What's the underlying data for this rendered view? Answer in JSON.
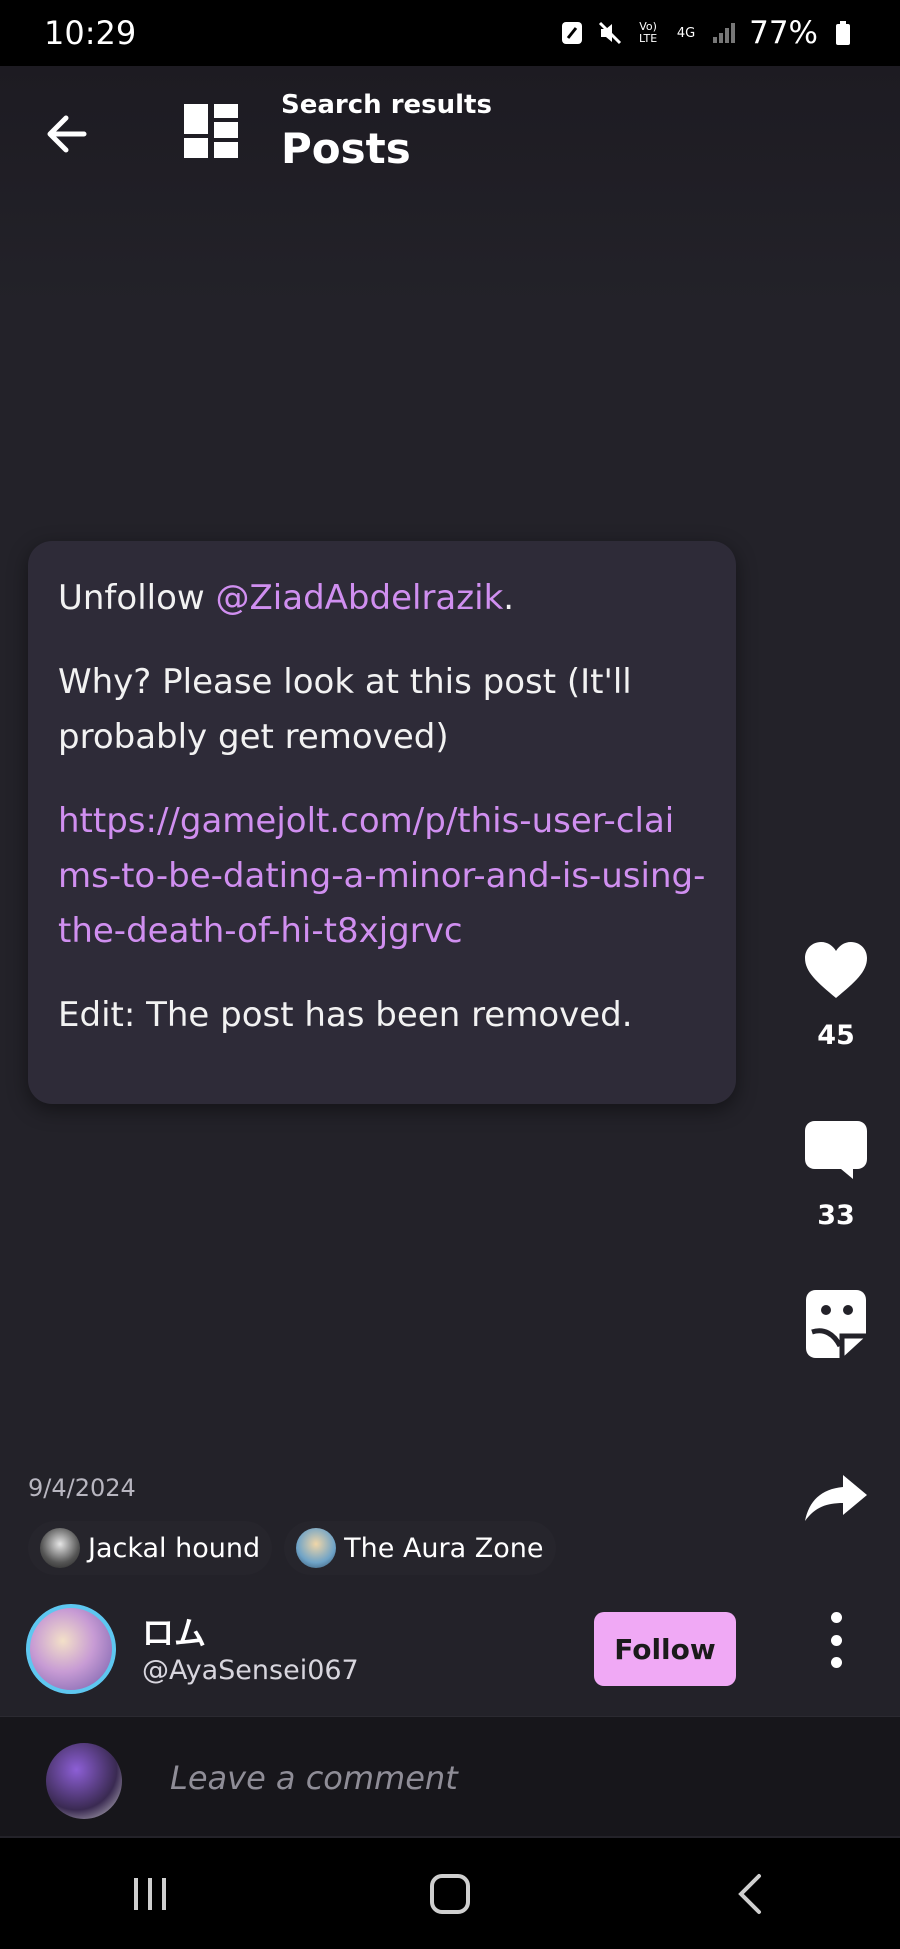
{
  "status_bar": {
    "time": "10:29",
    "battery": "77%",
    "icons": [
      "nfc-icon",
      "mute-icon",
      "volte-icon",
      "4g-icon",
      "signal-icon",
      "battery-icon"
    ],
    "volte_label_1": "Vo)",
    "volte_label_2": "LTE",
    "network_label": "4G"
  },
  "header": {
    "subtitle": "Search results",
    "title": "Posts",
    "back_icon": "arrow-left-icon",
    "grid_icon": "grid-layout-icon"
  },
  "post": {
    "line1_prefix": "Unfollow ",
    "mention": "@ZiadAbdelrazik",
    "line1_suffix": ".",
    "paragraph2": "Why? Please look at this post (It'll probably get removed)",
    "link": "https://gamejolt.com/p/this-user-claims-to-be-dating-a-minor-and-is-using-the-death-of-hi-t8xjgrvc",
    "paragraph4": "Edit: The post has been removed.",
    "date": "9/4/2024",
    "tags": [
      {
        "label": "Jackal hound"
      },
      {
        "label": "The Aura Zone"
      }
    ]
  },
  "actions": {
    "like_count": "45",
    "comment_count": "33",
    "like_icon": "heart-icon",
    "comment_icon": "comment-bubble-icon",
    "sticker_icon": "sticker-icon",
    "share_icon": "share-arrow-icon"
  },
  "author": {
    "name": "ロム",
    "handle": "@AyaSensei067",
    "follow_label": "Follow"
  },
  "comment": {
    "placeholder": "Leave a comment"
  },
  "colors": {
    "background": "#232229",
    "card": "#2e2b38",
    "accent_link": "#d08ff0",
    "follow_button": "#f0a9f5"
  }
}
